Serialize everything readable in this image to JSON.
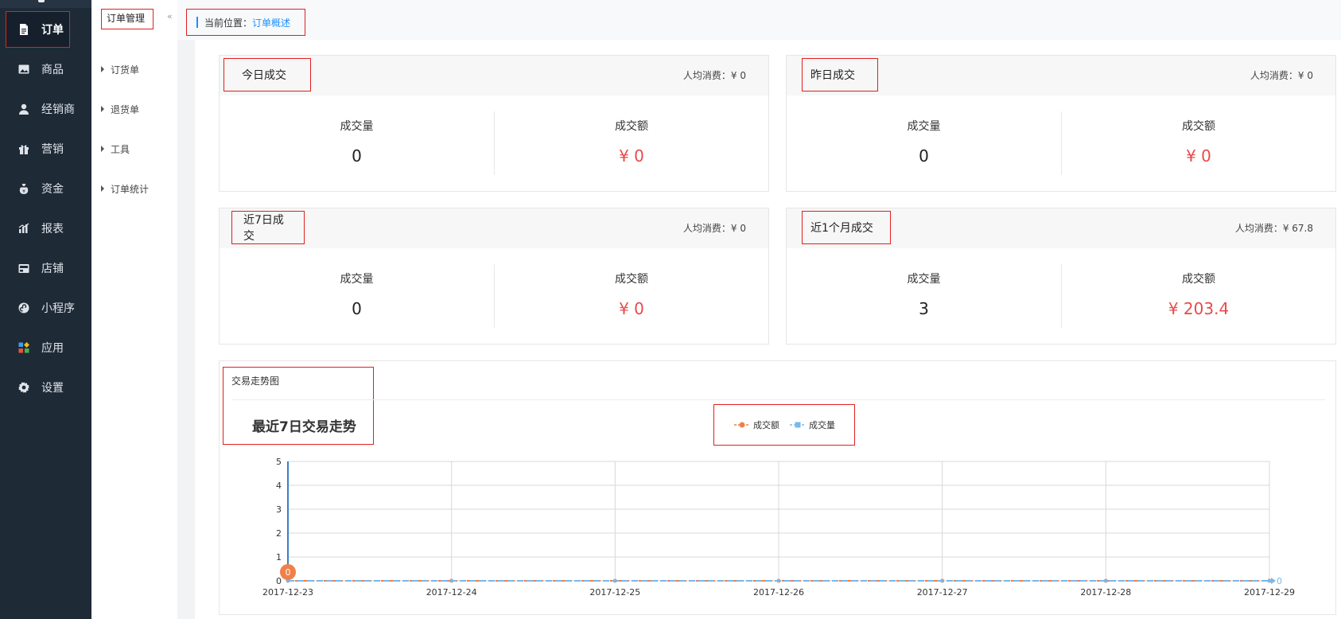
{
  "nav": {
    "items": [
      {
        "label": "订单",
        "icon": "document-icon",
        "active": true
      },
      {
        "label": "商品",
        "icon": "image-icon"
      },
      {
        "label": "经销商",
        "icon": "user-icon"
      },
      {
        "label": "营销",
        "icon": "gift-icon"
      },
      {
        "label": "资金",
        "icon": "money-bag-icon"
      },
      {
        "label": "报表",
        "icon": "bar-chart-icon"
      },
      {
        "label": "店铺",
        "icon": "store-icon"
      },
      {
        "label": "小程序",
        "icon": "mini-program-icon"
      },
      {
        "label": "应用",
        "icon": "apps-icon"
      },
      {
        "label": "设置",
        "icon": "gear-icon"
      }
    ]
  },
  "subnav": {
    "title": "订单管理",
    "items": [
      {
        "label": "订货单"
      },
      {
        "label": "退货单"
      },
      {
        "label": "工具"
      },
      {
        "label": "订单统计"
      }
    ]
  },
  "collapse_glyph": "«",
  "breadcrumb": {
    "prefix": "当前位置：",
    "current": "订单概述"
  },
  "cards": [
    {
      "title": "今日成交",
      "avg_label": "人均消费：¥ 0",
      "count_label": "成交量",
      "count": "0",
      "amount_label": "成交额",
      "amount": "¥ 0"
    },
    {
      "title": "昨日成交",
      "avg_label": "人均消费：¥ 0",
      "count_label": "成交量",
      "count": "0",
      "amount_label": "成交额",
      "amount": "¥ 0"
    },
    {
      "title": "近7日成交",
      "avg_label": "人均消费：¥ 0",
      "count_label": "成交量",
      "count": "0",
      "amount_label": "成交额",
      "amount": "¥ 0"
    },
    {
      "title": "近1个月成交",
      "avg_label": "人均消费：¥ 67.8",
      "count_label": "成交量",
      "count": "3",
      "amount_label": "成交额",
      "amount": "¥ 203.4"
    }
  ],
  "chart_panel": {
    "header": "交易走势图",
    "chart_title": "最近7日交易走势"
  },
  "colors": {
    "nav_bg": "#1f2a37",
    "accent": "#1e90ff",
    "money": "#e84a4a",
    "series_amount": "#f0804a",
    "series_count": "#7ab8e8",
    "highlight_box": "#e02020"
  },
  "chart_data": {
    "type": "line",
    "title": "最近7日交易走势",
    "x": [
      "2017-12-23",
      "2017-12-24",
      "2017-12-25",
      "2017-12-26",
      "2017-12-27",
      "2017-12-28",
      "2017-12-29"
    ],
    "ylim": [
      0,
      5
    ],
    "yticks": [
      0,
      1,
      2,
      3,
      4,
      5
    ],
    "grid": true,
    "legend": "top-center",
    "series": [
      {
        "name": "成交额",
        "values": [
          0,
          0,
          0,
          0,
          0,
          0,
          0
        ],
        "color": "#f0804a",
        "marker": "circle",
        "first_label": "0"
      },
      {
        "name": "成交量",
        "values": [
          0,
          0,
          0,
          0,
          0,
          0,
          0
        ],
        "color": "#7ab8e8",
        "marker": "square",
        "last_label": "0"
      }
    ]
  }
}
